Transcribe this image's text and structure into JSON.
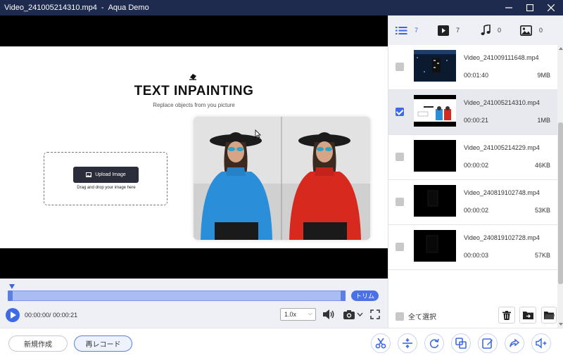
{
  "window": {
    "file_name": "Video_241005214310.mp4",
    "separator": "-",
    "app_name": "Aqua Demo",
    "colors": {
      "titlebar": "#1e2a4e",
      "accent": "#3f6ae6"
    }
  },
  "video_frame": {
    "heading": "TEXT INPAINTING",
    "subheading": "Replace objects from you picture",
    "upload_button": "Upload Image",
    "upload_hint": "Drag and drop your image here"
  },
  "timeline": {
    "trim_label": "トリム",
    "current_time": "00:00:00",
    "total_time": "00:00:21",
    "time_separator": "/ ",
    "speed": "1.0x"
  },
  "bottom": {
    "new_project": "新規作成",
    "rerecord": "再レコード"
  },
  "panel": {
    "tabs": [
      {
        "icon": "list-icon",
        "count": "7"
      },
      {
        "icon": "video-icon",
        "count": "7"
      },
      {
        "icon": "music-icon",
        "count": "0"
      },
      {
        "icon": "image-icon",
        "count": "0"
      }
    ],
    "files": [
      {
        "name": "Video_241009111648.mp4",
        "duration": "00:01:40",
        "size": "9MB",
        "checked": false
      },
      {
        "name": "Video_241005214310.mp4",
        "duration": "00:00:21",
        "size": "1MB",
        "checked": true
      },
      {
        "name": "Video_241005214229.mp4",
        "duration": "00:00:02",
        "size": "46KB",
        "checked": false
      },
      {
        "name": "Video_240819102748.mp4",
        "duration": "00:00:02",
        "size": "53KB",
        "checked": false
      },
      {
        "name": "Video_240819102728.mp4",
        "duration": "00:00:03",
        "size": "57KB",
        "checked": false
      }
    ],
    "select_all": "全て選択"
  }
}
